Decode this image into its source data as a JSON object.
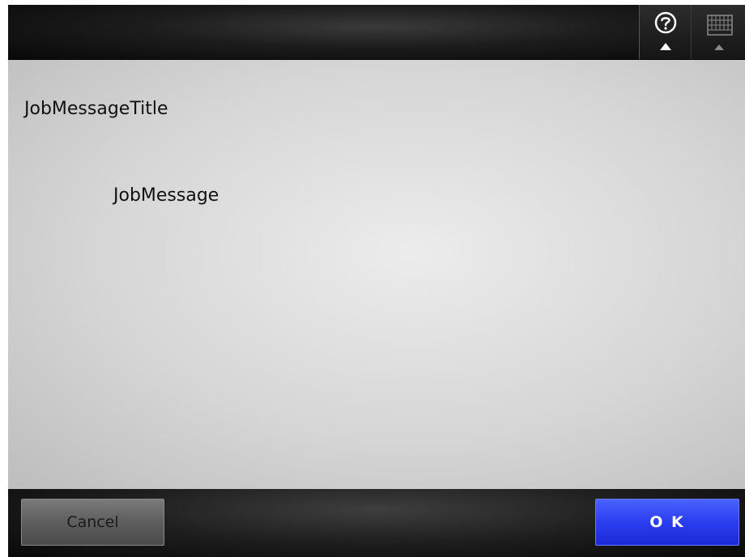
{
  "header": {
    "help_icon": "help-question-icon",
    "keyboard_icon": "keyboard-icon"
  },
  "message": {
    "title": "JobMessageTitle",
    "body": "JobMessage"
  },
  "footer": {
    "cancel_label": "Cancel",
    "ok_label": "O K"
  },
  "colors": {
    "ok_button": "#2b3ef0",
    "cancel_button": "#5e5e5e",
    "background": "#d6d6d6"
  }
}
